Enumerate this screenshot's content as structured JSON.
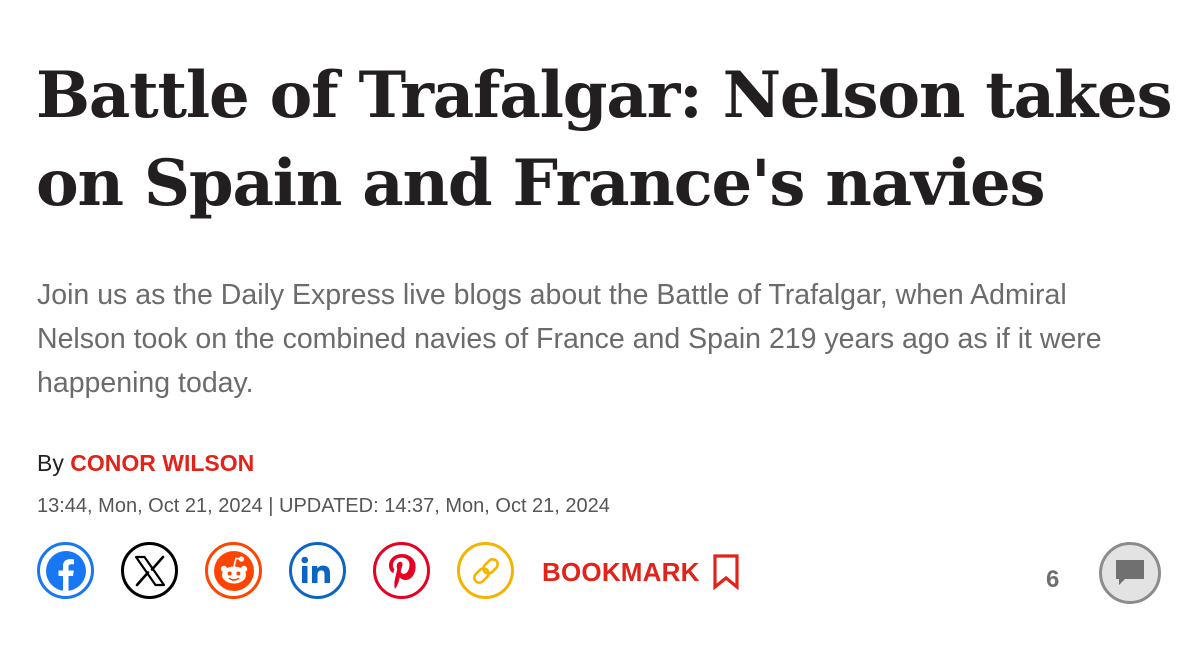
{
  "article": {
    "headline": "Battle of Trafalgar: Nelson takes on Spain and France's navies",
    "standfirst": "Join us as the Daily Express live blogs about the Battle of Trafalgar, when Admiral Nelson took on the combined navies of France and Spain 219 years ago as if it were happening today.",
    "byline_prefix": "By ",
    "author": "CONOR WILSON",
    "dateline": "13:44, Mon, Oct 21, 2024 | UPDATED: 14:37, Mon, Oct 21, 2024"
  },
  "share": {
    "buttons": [
      {
        "name": "facebook",
        "icon": "facebook-icon",
        "color": "#1877f2"
      },
      {
        "name": "x",
        "icon": "x-icon",
        "color": "#000000"
      },
      {
        "name": "reddit",
        "icon": "reddit-icon",
        "color": "#ff4500"
      },
      {
        "name": "linkedin",
        "icon": "linkedin-icon",
        "color": "#0a66c2"
      },
      {
        "name": "pinterest",
        "icon": "pinterest-icon",
        "color": "#e60023"
      },
      {
        "name": "copy-link",
        "icon": "link-icon",
        "color": "#f5b301"
      }
    ],
    "bookmark_label": "BOOKMARK",
    "bookmark_icon": "bookmark-icon",
    "accent_color": "#e2231a"
  },
  "comments": {
    "count": "6",
    "icon": "comment-icon"
  }
}
